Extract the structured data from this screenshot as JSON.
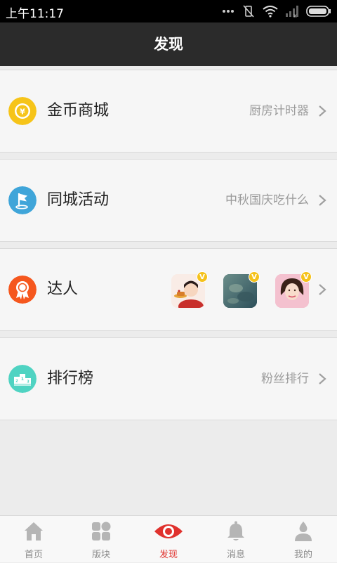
{
  "status_bar": {
    "time": "上午11:17"
  },
  "header": {
    "title": "发现"
  },
  "items": [
    {
      "label": "金币商城",
      "subtitle": "厨房计时器",
      "icon": "coin-icon",
      "color": "#f6c419"
    },
    {
      "label": "同城活动",
      "subtitle": "中秋国庆吃什么",
      "icon": "flag-icon",
      "color": "#3fa5d9"
    },
    {
      "label": "达人",
      "subtitle": "",
      "icon": "award-ribbon-icon",
      "color": "#f5571e",
      "avatar_badge": "V"
    },
    {
      "label": "排行榜",
      "subtitle": "粉丝排行",
      "icon": "podium-icon",
      "color": "#4fd3c2"
    }
  ],
  "tabs": [
    {
      "label": "首页",
      "icon": "home-icon",
      "active": false
    },
    {
      "label": "版块",
      "icon": "grid-blocks-icon",
      "active": false
    },
    {
      "label": "发现",
      "icon": "eye-icon",
      "active": true
    },
    {
      "label": "消息",
      "icon": "bell-icon",
      "active": false
    },
    {
      "label": "我的",
      "icon": "person-icon",
      "active": false
    }
  ],
  "colors": {
    "accent": "#e0322e",
    "header_bg": "#2b2b2b"
  }
}
